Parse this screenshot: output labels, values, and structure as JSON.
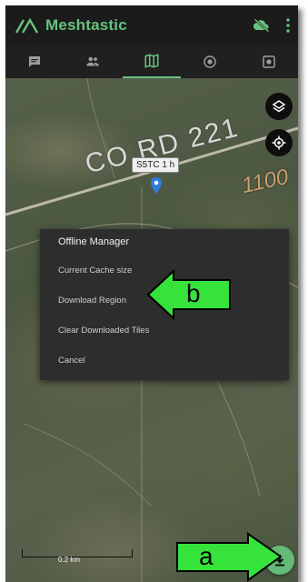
{
  "app": {
    "title": "Meshtastic"
  },
  "icons": {
    "logo": "meshtastic-logo-icon",
    "cloud_off": "cloud-off-icon",
    "more": "more-vert-icon"
  },
  "tabs": [
    {
      "name": "messages",
      "icon": "chat-icon"
    },
    {
      "name": "users",
      "icon": "people-icon"
    },
    {
      "name": "map",
      "icon": "map-icon",
      "active": true
    },
    {
      "name": "channel",
      "icon": "radio-icon"
    },
    {
      "name": "settings",
      "icon": "settings-icon"
    }
  ],
  "map": {
    "road_label": "CO RD 221",
    "road_number": "1100",
    "node_label": "S5TC 1 h",
    "scale_label": "0.2 km"
  },
  "dialog": {
    "title": "Offline Manager",
    "items": [
      "Current Cache size",
      "Download Region",
      "Clear Downloaded Tiles",
      "Cancel"
    ]
  },
  "annotations": {
    "a": "a",
    "b": "b"
  },
  "colors": {
    "accent": "#67c37f",
    "fab": "#64bb78",
    "annotation_arrow": "#35e33a",
    "dialog_bg": "#2d2d2d",
    "appbar": "#1b1b1b"
  }
}
